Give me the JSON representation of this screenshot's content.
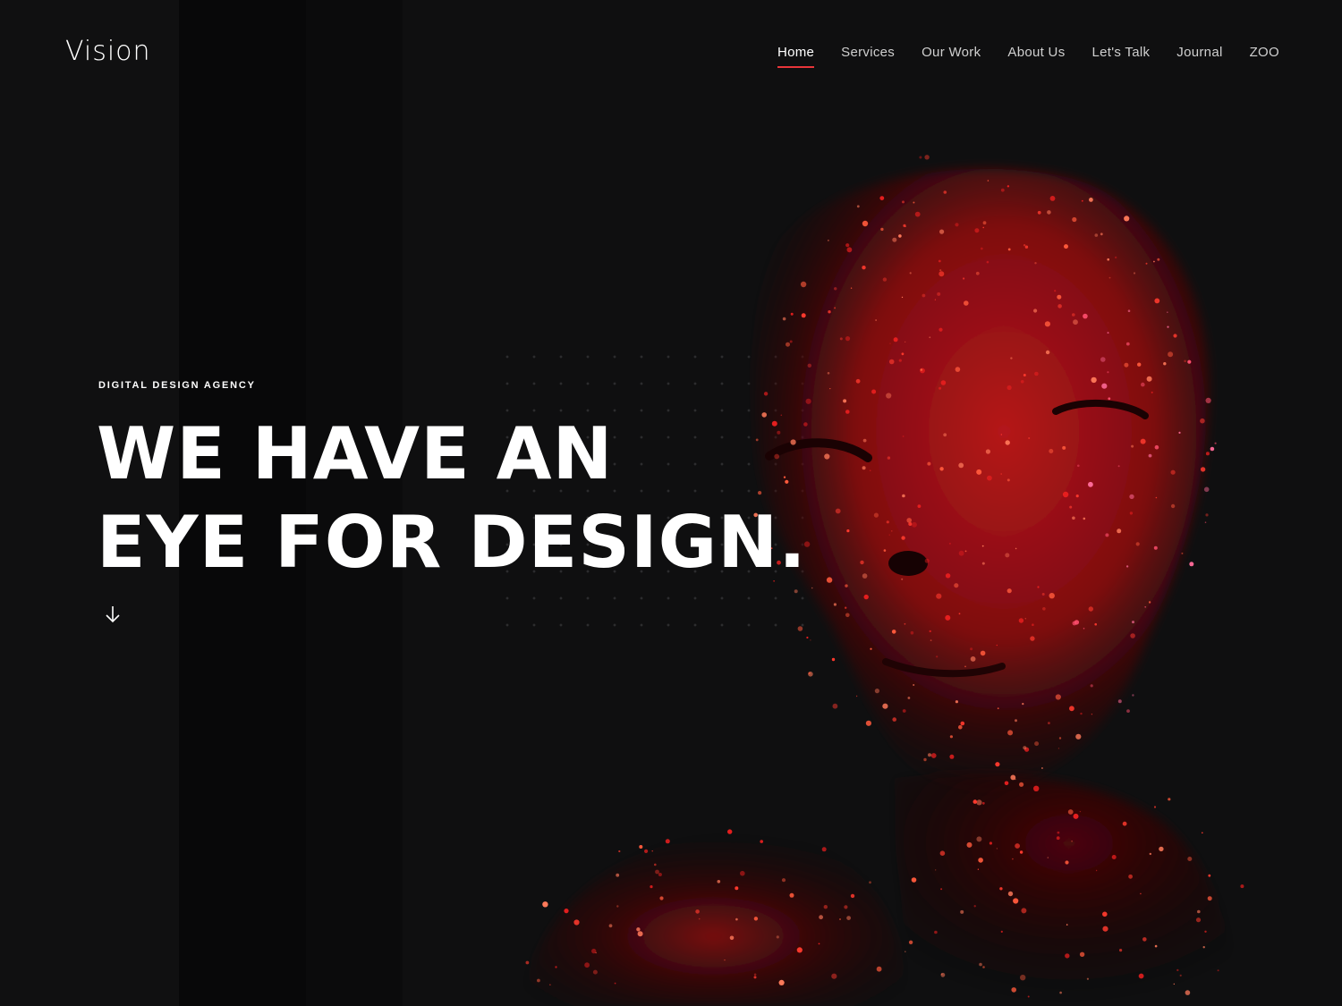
{
  "header": {
    "logo": "Vision",
    "nav": [
      {
        "label": "Home",
        "active": true
      },
      {
        "label": "Services",
        "active": false
      },
      {
        "label": "Our Work",
        "active": false
      },
      {
        "label": "About Us",
        "active": false
      },
      {
        "label": "Let's Talk",
        "active": false
      },
      {
        "label": "Journal",
        "active": false
      },
      {
        "label": "ZOO",
        "active": false
      }
    ]
  },
  "hero": {
    "eyebrow": "DIGITAL DESIGN AGENCY",
    "headline_line1": "WE HAVE AN",
    "headline_line2": "EYE FOR DESIGN.",
    "scroll_icon": "arrow-down-icon",
    "image": "red-glitter-face-portrait"
  },
  "colors": {
    "background": "#0e0e0f",
    "accent": "#e8353a",
    "text": "#ffffff",
    "nav_text": "#cfcfcf"
  }
}
